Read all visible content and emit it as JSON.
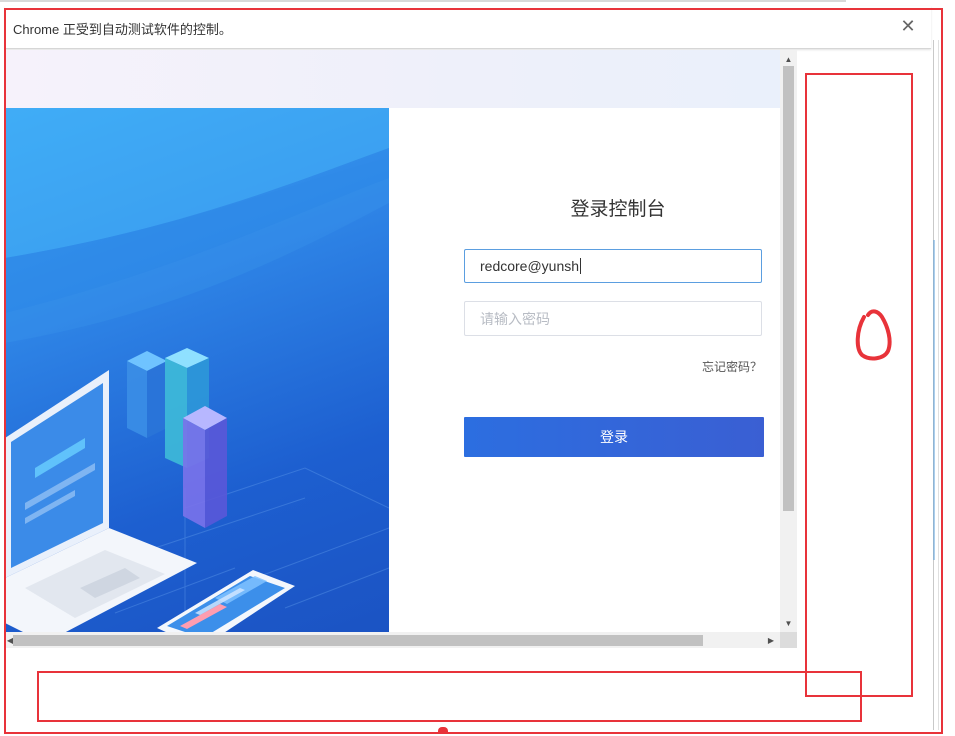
{
  "infobar": {
    "message": "Chrome 正受到自动测试软件的控制。",
    "close_icon": "close-icon"
  },
  "login": {
    "title": "登录控制台",
    "username_value": "redcore@yunsh",
    "password_placeholder": "请输入密码",
    "forgot_label": "忘记密码？",
    "submit_label": "登录"
  },
  "scrollbars": {
    "up_icon": "chevron-up-icon",
    "down_icon": "chevron-down-icon",
    "left_icon": "chevron-left-icon",
    "right_icon": "chevron-right-icon"
  },
  "colors": {
    "annotation_red": "#e8333a",
    "button_blue": "#2c6ee0",
    "illustration_blue": "#1d5fd0",
    "input_focus_border": "#5b9ee0"
  }
}
